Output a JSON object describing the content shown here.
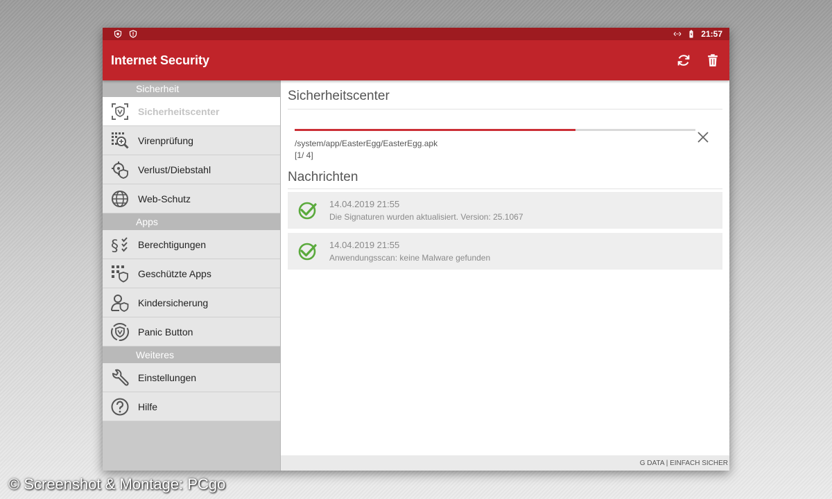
{
  "colors": {
    "appbar": "#c0242a",
    "statusbar": "#9e1b20",
    "accent": "#cc2f36",
    "check": "#5aaa3c"
  },
  "statusbar": {
    "left_icons": [
      "shield-badge-icon",
      "shield-alert-icon"
    ],
    "right_icons": [
      "data-transfer-icon",
      "battery-charging-icon"
    ],
    "time": "21:57"
  },
  "appbar": {
    "title": "Internet Security",
    "actions": [
      "refresh-icon",
      "trash-icon"
    ]
  },
  "sidebar": {
    "sections": [
      {
        "header": "Sicherheit",
        "items": [
          {
            "label": "Sicherheitscenter",
            "icon": "security-center-icon",
            "active": true
          },
          {
            "label": "Virenprüfung",
            "icon": "virus-scan-icon",
            "active": false
          },
          {
            "label": "Verlust/Diebstahl",
            "icon": "location-shield-icon",
            "active": false
          },
          {
            "label": "Web-Schutz",
            "icon": "globe-icon",
            "active": false
          }
        ]
      },
      {
        "header": "Apps",
        "items": [
          {
            "label": "Berechtigungen",
            "icon": "permissions-icon",
            "active": false
          },
          {
            "label": "Geschützte Apps",
            "icon": "protected-apps-icon",
            "active": false
          },
          {
            "label": "Kindersicherung",
            "icon": "parental-control-icon",
            "active": false
          },
          {
            "label": "Panic Button",
            "icon": "panic-button-icon",
            "active": false
          }
        ]
      },
      {
        "header": "Weiteres",
        "items": [
          {
            "label": "Einstellungen",
            "icon": "wrench-icon",
            "active": false
          },
          {
            "label": "Hilfe",
            "icon": "help-icon",
            "active": false
          }
        ]
      }
    ]
  },
  "main": {
    "title": "Sicherheitscenter",
    "scan": {
      "progress_percent": 70,
      "path": "/system/app/EasterEgg/EasterEgg.apk",
      "count": "[1/ 4]"
    },
    "news_title": "Nachrichten",
    "messages": [
      {
        "time": "14.04.2019 21:55",
        "text": "Die Signaturen wurden aktualisiert. Version: 25.1067",
        "icon": "check-circle-icon"
      },
      {
        "time": "14.04.2019 21:55",
        "text": "Anwendungsscan: keine Malware gefunden",
        "icon": "check-circle-icon"
      }
    ],
    "footer": "G DATA | EINFACH SICHER"
  },
  "credit": "© Screenshot & Montage: PCgo"
}
